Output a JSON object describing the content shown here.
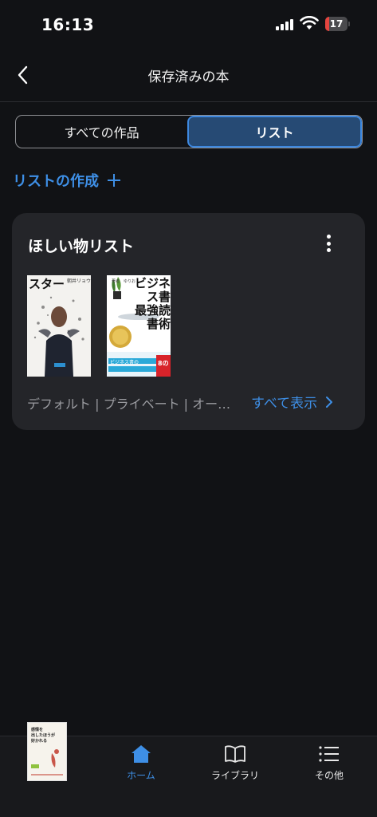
{
  "status_bar": {
    "time": "16:13",
    "battery": "17",
    "battery_level": 0.17
  },
  "header": {
    "title": "保存済みの本"
  },
  "segmented": {
    "tabs": [
      {
        "label": "すべての作品",
        "active": false
      },
      {
        "label": "リスト",
        "active": true
      }
    ]
  },
  "create_list": {
    "label": "リストの作成"
  },
  "list_card": {
    "title": "ほしい物リスト",
    "meta": "デフォルト | プライベート | オー…",
    "show_all": "すべて表示",
    "books": [
      {
        "title": "スター",
        "author": "朝井リョウ"
      },
      {
        "title_lines": [
          "ビジネス書",
          "最強読書術"
        ],
        "author": "著者　ゆりお",
        "badge": "8の",
        "bottom_text": "ビジネス書の"
      }
    ]
  },
  "now_reading": {
    "title_lines": [
      "感情を",
      "出したほうが",
      "好かれる"
    ]
  },
  "tab_bar": {
    "items": [
      {
        "label": "ホーム",
        "icon": "home-icon",
        "active": true
      },
      {
        "label": "ライブラリ",
        "icon": "book-icon",
        "active": false
      },
      {
        "label": "その他",
        "icon": "menu-list-icon",
        "active": false
      }
    ]
  },
  "colors": {
    "accent": "#3e8fe6",
    "background": "#111215",
    "card": "#242529",
    "segment_active": "#264a74",
    "battery_low": "#e5453f"
  }
}
